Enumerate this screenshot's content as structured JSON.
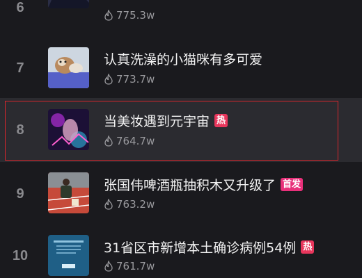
{
  "colors": {
    "background": "#1a1a1e",
    "highlight_row": "#2b2b30",
    "hot_badge": "#e8365c",
    "first_badge": "#e8307a",
    "selection_border": "#d9262c"
  },
  "items": [
    {
      "rank": "6",
      "title": "",
      "views": "775.3w",
      "badge": "",
      "thumb": "dark-figure-thumbnail"
    },
    {
      "rank": "7",
      "title": "认真洗澡的小猫咪有多可爱",
      "views": "773.7w",
      "badge": "",
      "thumb": "kitten-bath-thumbnail"
    },
    {
      "rank": "8",
      "title": "当美妆遇到元宇宙",
      "views": "764.7w",
      "badge": "热",
      "thumb": "neon-makeup-thumbnail"
    },
    {
      "rank": "9",
      "title": "张国伟啤酒瓶抽积木又升级了",
      "views": "763.2w",
      "badge": "首发",
      "thumb": "athlete-track-thumbnail"
    },
    {
      "rank": "10",
      "title": "31省区市新增本土确诊病例54例",
      "views": "761.7w",
      "badge": "热",
      "thumb": "news-card-thumbnail"
    }
  ],
  "icons": {
    "views": "flame-icon"
  }
}
